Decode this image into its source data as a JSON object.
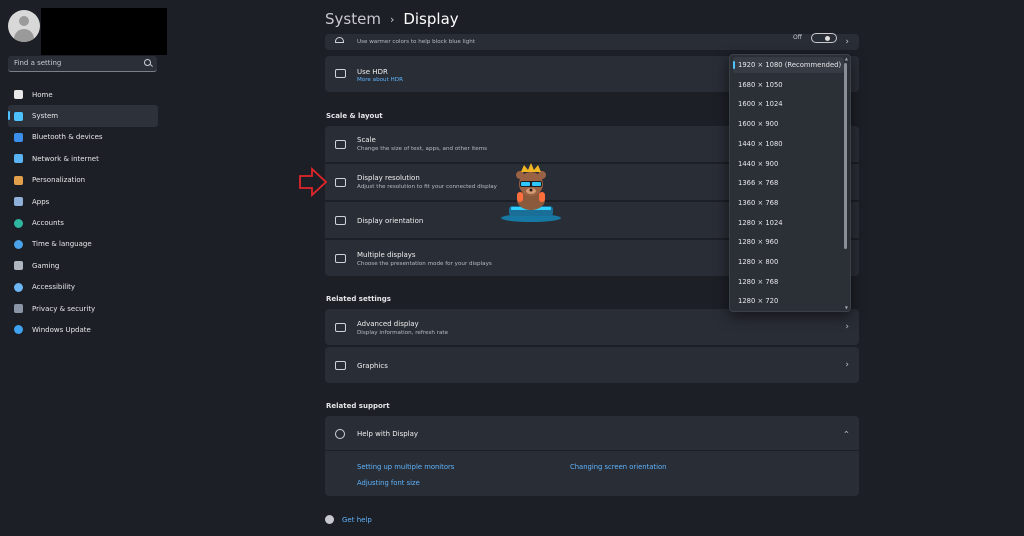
{
  "search": {
    "placeholder": "Find a setting"
  },
  "sidebar": {
    "items": [
      {
        "label": "Home",
        "icon": "home-icon",
        "color": "#e8e8e8"
      },
      {
        "label": "System",
        "icon": "monitor-icon",
        "color": "#4cc2ff"
      },
      {
        "label": "Bluetooth & devices",
        "icon": "bluetooth-icon",
        "color": "#3b8eea"
      },
      {
        "label": "Network & internet",
        "icon": "wifi-icon",
        "color": "#5ab3f2"
      },
      {
        "label": "Personalization",
        "icon": "brush-icon",
        "color": "#e3a04b"
      },
      {
        "label": "Apps",
        "icon": "apps-icon",
        "color": "#8fb1d9"
      },
      {
        "label": "Accounts",
        "icon": "person-icon",
        "color": "#2fb8a0"
      },
      {
        "label": "Time & language",
        "icon": "globe-clock-icon",
        "color": "#4aa3e8"
      },
      {
        "label": "Gaming",
        "icon": "gamepad-icon",
        "color": "#b0b6c0"
      },
      {
        "label": "Accessibility",
        "icon": "accessibility-icon",
        "color": "#6db7f5"
      },
      {
        "label": "Privacy & security",
        "icon": "shield-icon",
        "color": "#8a96a8"
      },
      {
        "label": "Windows Update",
        "icon": "update-icon",
        "color": "#3fa2f0"
      }
    ],
    "active": 1
  },
  "breadcrumb": {
    "parent": "System",
    "separator": "›",
    "current": "Display"
  },
  "night_light": {
    "subtitle": "Use warmer colors to help block blue light",
    "state": "Off"
  },
  "hdr": {
    "title": "Use HDR",
    "link": "More about HDR"
  },
  "scale_layout": {
    "title": "Scale & layout",
    "scale": {
      "title": "Scale",
      "subtitle": "Change the size of text, apps, and other items"
    },
    "resolution": {
      "title": "Display resolution",
      "subtitle": "Adjust the resolution to fit your connected display"
    },
    "orientation": {
      "title": "Display orientation"
    },
    "multiple": {
      "title": "Multiple displays",
      "subtitle": "Choose the presentation mode for your displays"
    }
  },
  "related_settings": {
    "title": "Related settings",
    "advanced": {
      "title": "Advanced display",
      "subtitle": "Display information, refresh rate"
    },
    "graphics": {
      "title": "Graphics"
    }
  },
  "related_support": {
    "title": "Related support",
    "help": {
      "title": "Help with Display"
    },
    "links": [
      "Setting up multiple monitors",
      "Changing screen orientation",
      "Adjusting font size"
    ]
  },
  "get_help": "Get help",
  "resolution_dropdown": {
    "options": [
      "1920 × 1080 (Recommended)",
      "1680 × 1050",
      "1600 × 1024",
      "1600 × 900",
      "1440 × 1080",
      "1440 × 900",
      "1366 × 768",
      "1360 × 768",
      "1280 × 1024",
      "1280 × 960",
      "1280 × 800",
      "1280 × 768",
      "1280 × 720"
    ],
    "selected": 0
  }
}
